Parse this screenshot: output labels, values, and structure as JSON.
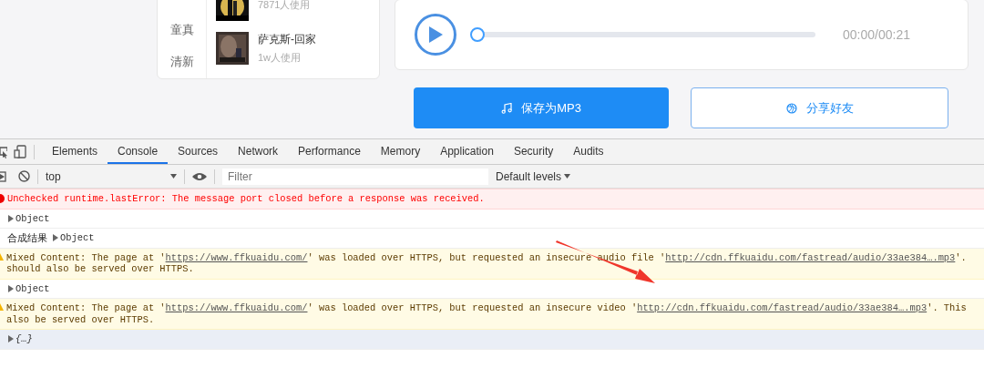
{
  "sidebar": {
    "categories": [
      {
        "label": "童真",
        "selected": false
      },
      {
        "label": "清新",
        "selected": false
      }
    ]
  },
  "songs": [
    {
      "usage": "7871人使用"
    },
    {
      "title": "萨克斯-回家",
      "usage": "1w人使用"
    }
  ],
  "player": {
    "level": 0,
    "time": "00:00/00:21"
  },
  "buttons": [
    {
      "kind": "primary",
      "label": "保存为MP3"
    },
    {
      "kind": "secondary",
      "label": "分享好友"
    }
  ],
  "devtools": {
    "tabs": [
      {
        "label": "Elements",
        "selected": false
      },
      {
        "label": "Console",
        "selected": true
      },
      {
        "label": "Sources",
        "selected": false
      },
      {
        "label": "Network",
        "selected": false
      },
      {
        "label": "Performance",
        "selected": false
      },
      {
        "label": "Memory",
        "selected": false
      },
      {
        "label": "Application",
        "selected": false
      },
      {
        "label": "Security",
        "selected": false
      },
      {
        "label": "Audits",
        "selected": false
      }
    ],
    "context": "top",
    "filter_placeholder": "Filter",
    "levels": "Default levels",
    "messages": [
      {
        "kind": "error",
        "lines": [
          [
            {
              "text": "Unchecked runtime.lastError: The message port closed before a response was received."
            }
          ]
        ]
      },
      {
        "kind": "object",
        "label": "Object"
      },
      {
        "kind": "log",
        "prefix": "合成结果",
        "label": "Object"
      },
      {
        "kind": "warning",
        "lines": [
          [
            {
              "text": "Mixed Content: The page at '"
            },
            {
              "text": "https://www.ffkuaidu.com/",
              "link": true
            },
            {
              "text": "' was loaded over HTTPS, but requested an insecure audio file '"
            },
            {
              "text": "http://cdn.ffkuaidu.com/fastread/audio/33ae384….mp3",
              "link": true
            },
            {
              "text": "'."
            }
          ],
          [
            {
              "text": "should also be served over HTTPS."
            }
          ]
        ]
      },
      {
        "kind": "object",
        "label": "Object"
      },
      {
        "kind": "warning",
        "lines": [
          [
            {
              "text": "Mixed Content: The page at '"
            },
            {
              "text": "https://www.ffkuaidu.com/",
              "link": true
            },
            {
              "text": "' was loaded over HTTPS, but requested an insecure video '"
            },
            {
              "text": "http://cdn.ffkuaidu.com/fastread/audio/33ae384….mp3",
              "link": true
            },
            {
              "text": "'. This"
            }
          ],
          [
            {
              "text": "also be served over HTTPS."
            }
          ]
        ]
      },
      {
        "kind": "result",
        "label": "{…}"
      }
    ]
  },
  "annotation": {
    "kind": "arrow"
  }
}
